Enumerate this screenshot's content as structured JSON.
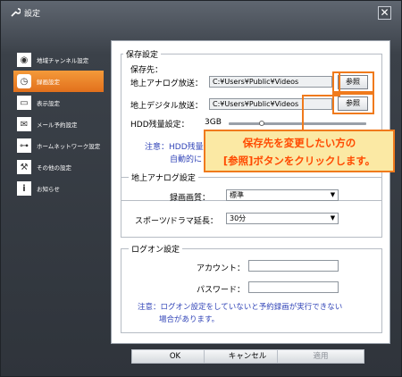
{
  "window": {
    "title": "設定"
  },
  "sidebar": {
    "items": [
      {
        "label": "地域チャンネル設定",
        "icon": "satellite-icon"
      },
      {
        "label": "録画設定",
        "icon": "record-icon",
        "active": true
      },
      {
        "label": "表示設定",
        "icon": "display-icon"
      },
      {
        "label": "メール予約設定",
        "icon": "mail-icon"
      },
      {
        "label": "ホームネットワーク設定",
        "icon": "network-icon"
      },
      {
        "label": "その他の設定",
        "icon": "wrench-icon"
      },
      {
        "label": "お知らせ",
        "icon": "info-icon"
      }
    ]
  },
  "storage": {
    "group_label": "保存設定",
    "dest_label": "保存先：",
    "analog_label": "地上アナログ放送：",
    "analog_path": "C:¥Users¥Public¥Videos",
    "digital_label": "地上デジタル放送：",
    "digital_path": "C:¥Users¥Public¥Videos",
    "browse_label": "参照",
    "hdd_label": "HDD残量設定：",
    "hdd_value": "3GB",
    "note_line1": "注意：HDD残量",
    "note_line2": "自動的に"
  },
  "analog": {
    "group_label": "地上アナログ設定",
    "quality_label": "録画画質：",
    "quality_value": "標準",
    "extension_label": "スポーツ/ドラマ延長：",
    "extension_value": "30分"
  },
  "logon": {
    "group_label": "ログオン設定",
    "account_label": "アカウント：",
    "password_label": "パスワード：",
    "note_line1": "注意：ログオン設定をしていないと予約録画が実行できない",
    "note_line2": "場合があります。"
  },
  "callout": {
    "line1": "保存先を変更したい方の",
    "line2": "[参照]ボタンをクリックします。"
  },
  "buttons": {
    "ok": "OK",
    "cancel": "キャンセル",
    "apply": "適用"
  },
  "colors": {
    "accent": "#f07a1c",
    "note": "#3346b8",
    "callout_text": "#ff4a00",
    "callout_bg": "#fbe9a4"
  }
}
